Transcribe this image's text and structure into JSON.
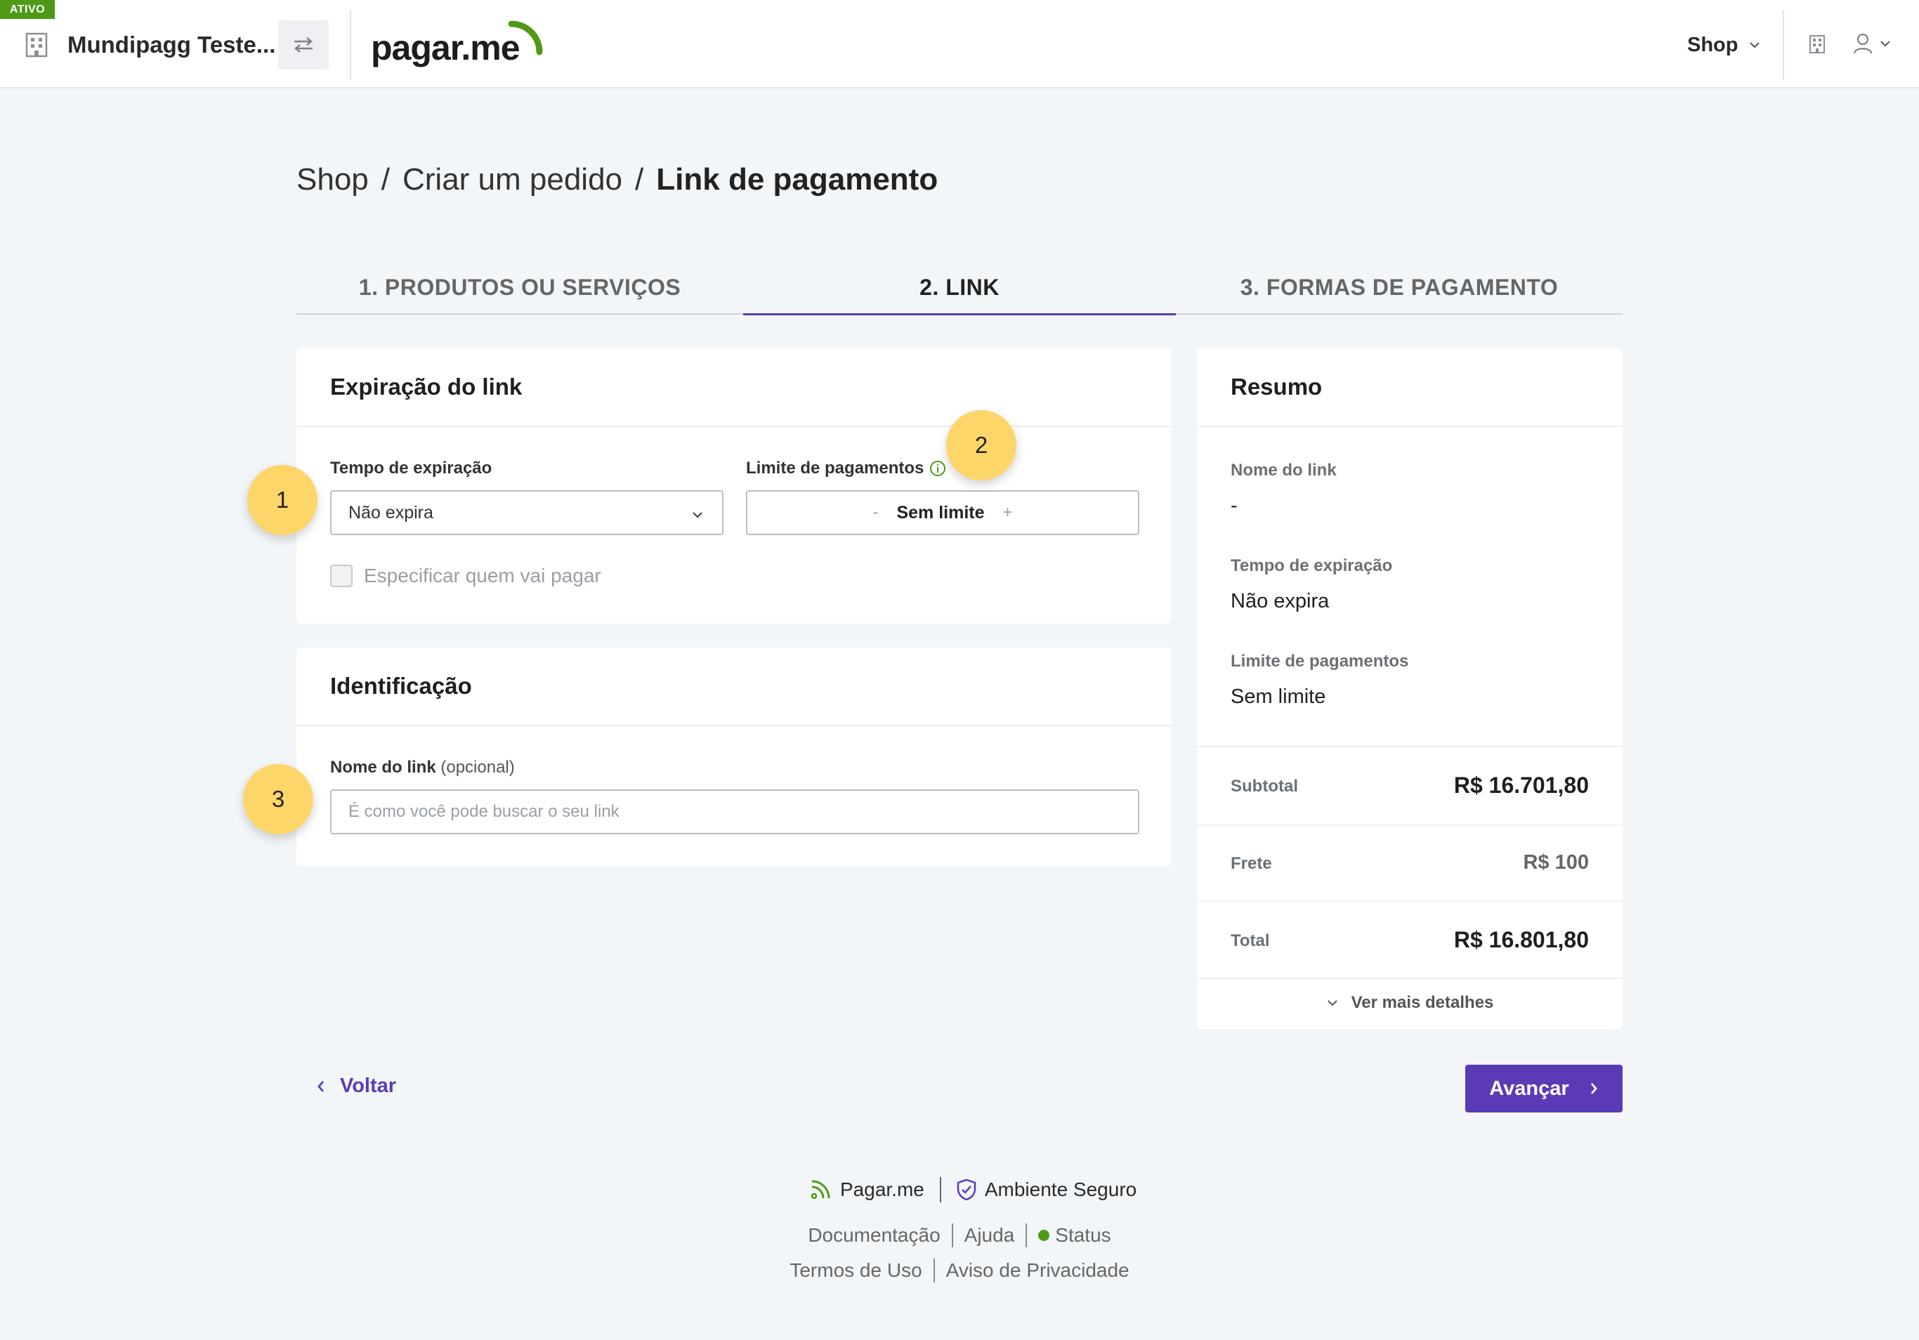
{
  "header": {
    "status_badge": "ATIVO",
    "company_name": "Mundipagg Teste...",
    "brand": "pagar.me",
    "shop_menu": "Shop"
  },
  "breadcrumb": {
    "items": [
      "Shop",
      "Criar um pedido",
      "Link de pagamento"
    ],
    "separator": "/"
  },
  "steps": [
    {
      "number": "1.",
      "label": "PRODUTOS OU SERVIÇOS",
      "active": false
    },
    {
      "number": "2.",
      "label": "LINK",
      "active": true
    },
    {
      "number": "3.",
      "label": "FORMAS DE PAGAMENTO",
      "active": false
    }
  ],
  "expiration_card": {
    "title": "Expiração do link",
    "expiration_label": "Tempo de expiração",
    "expiration_value": "Não expira",
    "limit_label": "Limite de pagamentos",
    "limit_minus": "-",
    "limit_value": "Sem limite",
    "limit_plus": "+",
    "payer_checkbox_label": "Especificar quem vai pagar"
  },
  "identification_card": {
    "title": "Identificação",
    "name_label": "Nome do link",
    "name_optional": "(opcional)",
    "name_placeholder": "É como você pode buscar o seu link"
  },
  "annotations": [
    "1",
    "2",
    "3"
  ],
  "summary": {
    "title": "Resumo",
    "link_name_label": "Nome do link",
    "link_name_value": "-",
    "expiration_label": "Tempo de expiração",
    "expiration_value": "Não expira",
    "limit_label": "Limite de pagamentos",
    "limit_value": "Sem limite",
    "subtotal_label": "Subtotal",
    "subtotal_value": "R$ 16.701,80",
    "frete_label": "Frete",
    "frete_value": "R$ 100",
    "total_label": "Total",
    "total_value": "R$ 16.801,80",
    "details_toggle": "Ver mais detalhes"
  },
  "actions": {
    "back": "Voltar",
    "next": "Avançar"
  },
  "footer": {
    "brand": "Pagar.me",
    "secure": "Ambiente Seguro",
    "links_row1": [
      "Documentação",
      "Ajuda",
      "Status"
    ],
    "links_row2": [
      "Termos de Uso",
      "Aviso de Privacidade"
    ]
  },
  "colors": {
    "accent": "#5b3ab6",
    "brand_green": "#4e9a16",
    "annotation": "#fdd66a"
  }
}
